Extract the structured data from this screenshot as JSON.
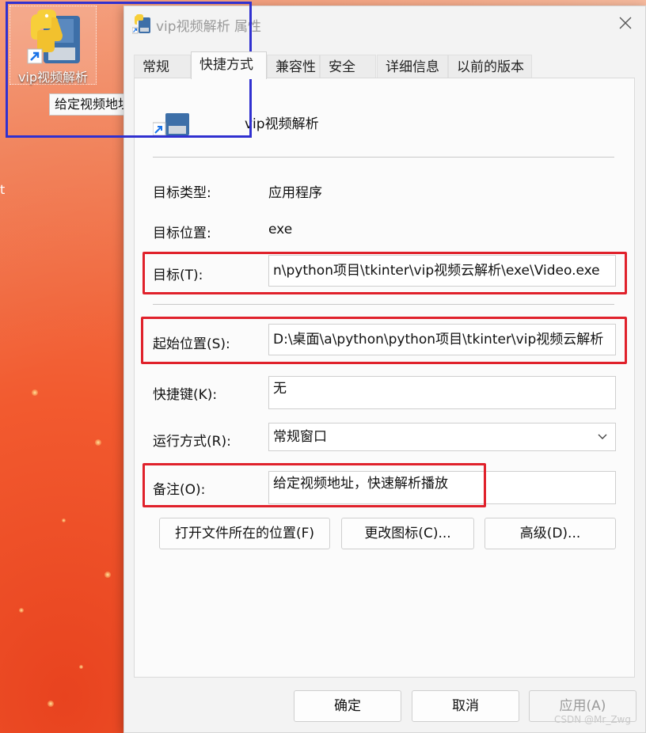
{
  "desktop": {
    "icon_label": "vip视频解析",
    "tooltip": "给定视频地址，快速解析播放",
    "edge_text": "t"
  },
  "dialog": {
    "title": "vip视频解析 属性",
    "tabs": [
      {
        "label": "常规"
      },
      {
        "label": "快捷方式"
      },
      {
        "label": "兼容性"
      },
      {
        "label": "安全"
      },
      {
        "label": "详细信息"
      },
      {
        "label": "以前的版本"
      }
    ],
    "active_tab": "快捷方式",
    "app_name": "vip视频解析",
    "target_type_label": "目标类型:",
    "target_type_value": "应用程序",
    "target_location_label": "目标位置:",
    "target_location_value": "exe",
    "target_label": "目标(T):",
    "target_value": "n\\python项目\\tkinter\\vip视频云解析\\exe\\Video.exe",
    "start_in_label": "起始位置(S):",
    "start_in_value": "D:\\桌面\\a\\python\\python项目\\tkinter\\vip视频云解析",
    "hotkey_label": "快捷键(K):",
    "hotkey_value": "无",
    "run_label": "运行方式(R):",
    "run_value": "常规窗口",
    "comment_label": "备注(O):",
    "comment_value": "给定视频地址，快速解析播放",
    "open_location_button": "打开文件所在的位置(F)",
    "change_icon_button": "更改图标(C)...",
    "advanced_button": "高级(D)...",
    "ok_button": "确定",
    "cancel_button": "取消",
    "apply_button": "应用(A)"
  },
  "watermark": "CSDN @Mr_Zwg",
  "colors": {
    "annotation_red": "#e0212b",
    "annotation_blue": "#3030d0"
  }
}
